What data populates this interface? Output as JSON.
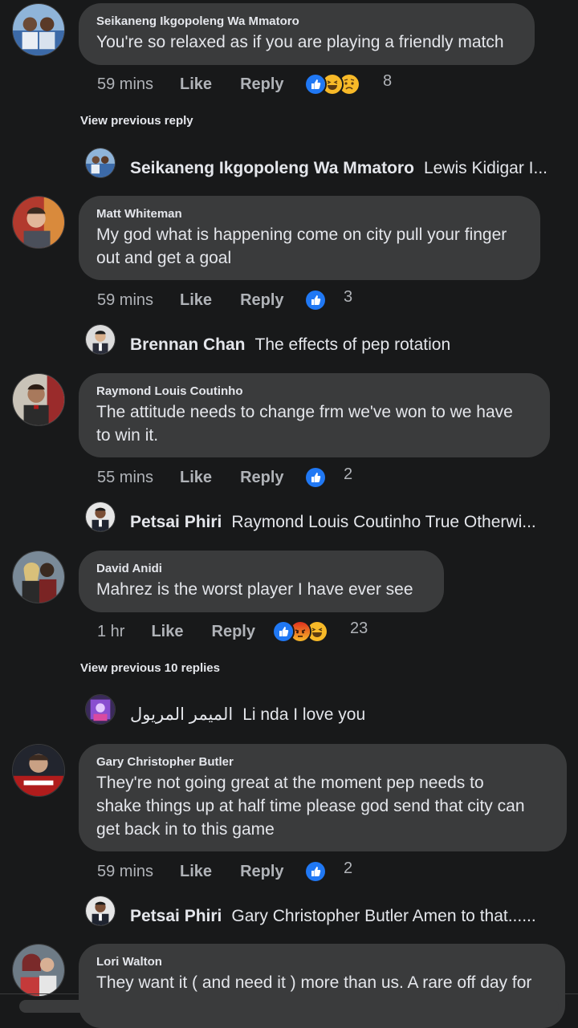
{
  "comments": [
    {
      "name": "Seikaneng Ikgopoleng Wa Mmatoro",
      "text": [
        "You're so relaxed as if you are playing a friendly match"
      ],
      "time": "59 mins",
      "like": "Like",
      "reply": "Reply",
      "reactions": [
        "like",
        "haha",
        "sad"
      ],
      "count": "8"
    },
    {
      "name": "Matt Whiteman",
      "text": [
        "My god what is happening come on city pull your finger",
        "out and get a goal"
      ],
      "time": "59 mins",
      "like": "Like",
      "reply": "Reply",
      "reactions": [
        "like"
      ],
      "count": "3"
    },
    {
      "name": "Raymond Louis Coutinho",
      "text": [
        "The attitude needs to change frm we've won to we have",
        "to win it."
      ],
      "time": "55 mins",
      "like": "Like",
      "reply": "Reply",
      "reactions": [
        "like"
      ],
      "count": "2"
    },
    {
      "name": "David Anidi",
      "text": [
        "Mahrez is the worst player I have ever see"
      ],
      "time": "1 hr",
      "like": "Like",
      "reply": "Reply",
      "reactions": [
        "like",
        "angry",
        "haha"
      ],
      "count": "23"
    },
    {
      "name": "Gary Christopher Butler",
      "text": [
        "They're  not going great at the moment pep needs to",
        "shake things up at half time  please god  send that city can",
        "get back in to this game"
      ],
      "time": "59 mins",
      "like": "Like",
      "reply": "Reply",
      "reactions": [
        "like"
      ],
      "count": "2"
    },
    {
      "name": "Lori Walton",
      "text": [
        "They want it ( and need it ) more than us. A rare off day for"
      ]
    }
  ],
  "view_previous_reply": "View previous reply",
  "view_previous_10": "View previous 10 replies",
  "replies": [
    {
      "name": "Seikaneng Ikgopoleng Wa Mmatoro",
      "text": "Lewis Kidigar I..."
    },
    {
      "name": "Brennan Chan",
      "text": "The effects of pep rotation"
    },
    {
      "name": "Petsai Phiri",
      "text": "Raymond Louis Coutinho True Otherwi..."
    },
    {
      "name": "الميمر المريول",
      "text": "Li nda I love you"
    },
    {
      "name": "Petsai Phiri",
      "text": "Gary Christopher Butler Amen to that......"
    }
  ],
  "colors": {
    "background": "#18191a",
    "bubble": "#3a3b3c",
    "like_blue": "#2078f4",
    "haha_yellow": "#f7b928",
    "angry_orange": "#e9710f"
  }
}
